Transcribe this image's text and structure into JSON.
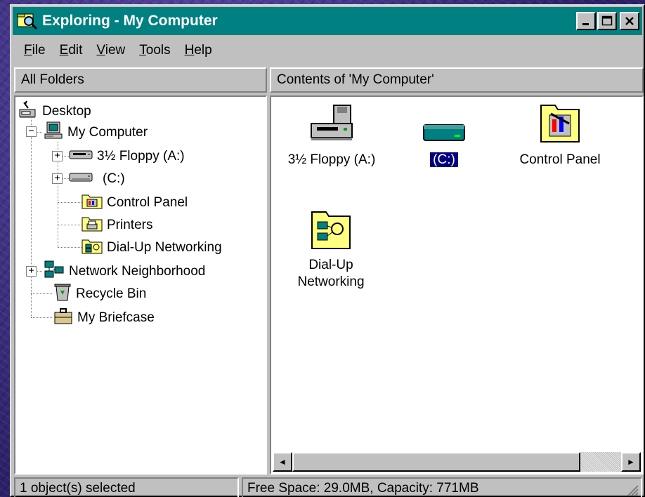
{
  "window": {
    "title": "Exploring - My Computer",
    "minimize_label": "_",
    "maximize_label": "□",
    "close_label": "×"
  },
  "menu": [
    {
      "pre": "",
      "key": "F",
      "post": "ile"
    },
    {
      "pre": "",
      "key": "E",
      "post": "dit"
    },
    {
      "pre": "",
      "key": "V",
      "post": "iew"
    },
    {
      "pre": "",
      "key": "T",
      "post": "ools"
    },
    {
      "pre": "",
      "key": "H",
      "post": "elp"
    }
  ],
  "left_header": "All Folders",
  "right_header": "Contents of 'My Computer'",
  "tree": [
    {
      "label": "Desktop",
      "icon": "desktop-icon"
    },
    {
      "label": "My Computer",
      "icon": "computer-icon",
      "expander": "−"
    },
    {
      "label": "3½ Floppy (A:)",
      "icon": "floppy-drive-icon",
      "expander": "+"
    },
    {
      "label": "(C:)",
      "icon": "hard-drive-icon",
      "expander": "+"
    },
    {
      "label": "Control Panel",
      "icon": "control-panel-icon"
    },
    {
      "label": "Printers",
      "icon": "printers-icon"
    },
    {
      "label": "Dial-Up Networking",
      "icon": "dialup-networking-icon"
    },
    {
      "label": "Network Neighborhood",
      "icon": "network-neighborhood-icon",
      "expander": "+"
    },
    {
      "label": "Recycle Bin",
      "icon": "recycle-bin-icon"
    },
    {
      "label": "My Briefcase",
      "icon": "briefcase-icon"
    }
  ],
  "contents": [
    {
      "label": "3½ Floppy (A:)",
      "icon": "floppy-drive-icon"
    },
    {
      "label": "(C:)",
      "icon": "hard-drive-icon",
      "selected": true
    },
    {
      "label": "Control Panel",
      "icon": "control-panel-icon"
    },
    {
      "label_line1": "Dial-Up",
      "label_line2": "Networking",
      "icon": "dialup-networking-icon"
    }
  ],
  "scrollbar": {
    "left_arrow": "◄",
    "right_arrow": "►"
  },
  "status": {
    "selection": "1 object(s) selected",
    "space": "Free Space: 29.0MB,  Capacity: 771MB"
  },
  "colors": {
    "title_bar": "#008080",
    "face": "#c0c0c0",
    "selection": "#000080",
    "folder": "#ffff80"
  }
}
